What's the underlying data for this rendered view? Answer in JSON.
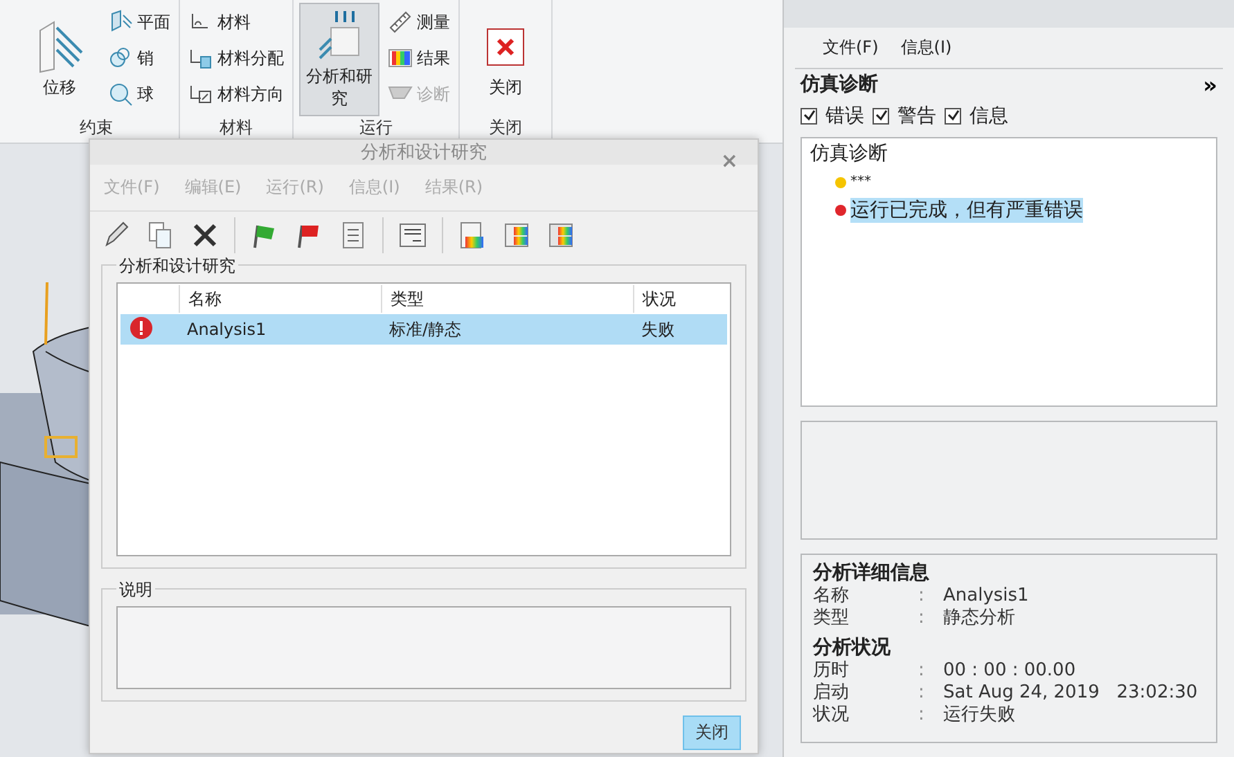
{
  "ribbon": {
    "groups": [
      {
        "label": "约束",
        "items": [
          {
            "label": "位移",
            "kind": "large",
            "selected": false,
            "disabled": false
          },
          {
            "label": "平面",
            "kind": "small",
            "selected": false,
            "disabled": false
          },
          {
            "label": "销",
            "kind": "small",
            "selected": false,
            "disabled": false
          },
          {
            "label": "球",
            "kind": "small",
            "selected": false,
            "disabled": false
          }
        ]
      },
      {
        "label": "材料",
        "items": [
          {
            "label": "材料",
            "kind": "small",
            "selected": false,
            "disabled": false
          },
          {
            "label": "材料分配",
            "kind": "small",
            "selected": false,
            "disabled": false
          },
          {
            "label": "材料方向",
            "kind": "small",
            "selected": false,
            "disabled": false
          }
        ]
      },
      {
        "label": "运行",
        "items": [
          {
            "label": "分析和研究",
            "kind": "large",
            "selected": true,
            "disabled": false
          },
          {
            "label": "测量",
            "kind": "small",
            "selected": false,
            "disabled": false
          },
          {
            "label": "结果",
            "kind": "small",
            "selected": false,
            "disabled": false
          },
          {
            "label": "诊断",
            "kind": "small",
            "selected": false,
            "disabled": true
          }
        ]
      },
      {
        "label": "关闭",
        "items": [
          {
            "label": "关闭",
            "kind": "large",
            "selected": false,
            "disabled": false
          }
        ]
      }
    ]
  },
  "dialog": {
    "title": "分析和设计研究",
    "close": "×",
    "menu": [
      {
        "label": "文件(F)",
        "disabled": true
      },
      {
        "label": "编辑(E)",
        "disabled": true
      },
      {
        "label": "运行(R)",
        "disabled": true
      },
      {
        "label": "信息(I)",
        "disabled": true
      },
      {
        "label": "结果(R)",
        "disabled": true
      }
    ],
    "studies": {
      "title": "分析和设计研究",
      "columns": [
        "名称",
        "类型",
        "状况"
      ],
      "rows": [
        {
          "name": "Analysis1",
          "type": "标准/静态",
          "status": "失败",
          "selected": true
        }
      ]
    },
    "description": {
      "title": "说明"
    },
    "buttons": [
      {
        "label": "关闭",
        "selected": true
      }
    ]
  },
  "diagnostics": {
    "menu": [
      "文件(F)",
      "信息(I)"
    ],
    "title": "仿真诊断",
    "expand": "»",
    "filters": [
      {
        "label": "错误",
        "checked": true
      },
      {
        "label": "警告",
        "checked": true
      },
      {
        "label": "信息",
        "checked": true
      }
    ],
    "tree": {
      "label": "仿真诊断",
      "children": [
        {
          "label": "***",
          "color": "#f5c400",
          "selected": false
        },
        {
          "label": "运行已完成，但有严重错误",
          "color": "#e0262c",
          "selected": true
        }
      ]
    },
    "details": [
      {
        "title": "分析详细信息",
        "rows": [
          {
            "label": "名称",
            "separator": ":",
            "value": "Analysis1"
          },
          {
            "label": "类型",
            "separator": ":",
            "value": "静态分析"
          }
        ]
      },
      {
        "title": "分析状况",
        "rows": [
          {
            "label": "历时",
            "separator": ":",
            "value": "00 : 00 : 00.00"
          },
          {
            "label": "启动",
            "separator": ":",
            "value": "Sat Aug 24, 2019   23:02:30"
          },
          {
            "label": "状况",
            "separator": ":",
            "value": "运行失败"
          }
        ]
      }
    ]
  }
}
